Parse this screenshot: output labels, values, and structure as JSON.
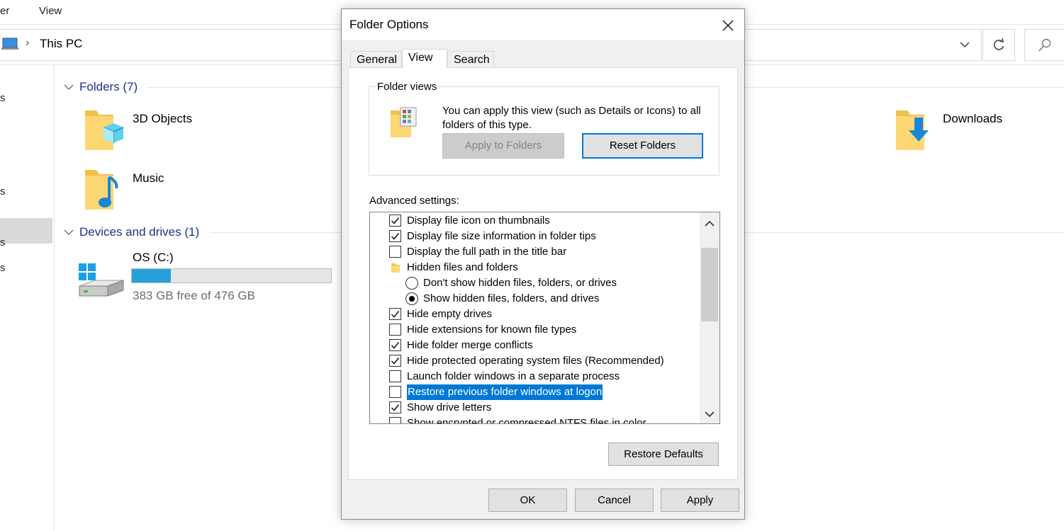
{
  "explorer": {
    "ribbon_tabs": [
      "er",
      "View"
    ],
    "breadcrumb": "This PC",
    "nav_fragments": [
      "s",
      "s",
      "s",
      "s"
    ],
    "groups": [
      {
        "label": "Folders (7)"
      },
      {
        "label": "Devices and drives (1)"
      }
    ],
    "folders": [
      {
        "name": "3D Objects",
        "icon": "3d-objects-folder-icon"
      },
      {
        "name": "Music",
        "icon": "music-folder-icon"
      },
      {
        "name": "Downloads",
        "icon": "downloads-folder-icon"
      }
    ],
    "drive": {
      "name": "OS (C:)",
      "free_text": "383 GB free of 476 GB",
      "used_fraction": 0.195,
      "bar_color": "#26a0da"
    }
  },
  "dialog": {
    "title": "Folder Options",
    "tabs": [
      "General",
      "View",
      "Search"
    ],
    "active_tab": "View",
    "folder_views": {
      "legend": "Folder views",
      "description": "You can apply this view (such as Details or Icons) to all folders of this type.",
      "apply_label": "Apply to Folders",
      "reset_label": "Reset Folders"
    },
    "advanced_label": "Advanced settings:",
    "settings": [
      {
        "kind": "checkbox",
        "checked": true,
        "label": "Display file icon on thumbnails"
      },
      {
        "kind": "checkbox",
        "checked": true,
        "label": "Display file size information in folder tips"
      },
      {
        "kind": "checkbox",
        "checked": false,
        "label": "Display the full path in the title bar"
      },
      {
        "kind": "folder",
        "label": "Hidden files and folders"
      },
      {
        "kind": "radio",
        "checked": false,
        "label": "Don't show hidden files, folders, or drives"
      },
      {
        "kind": "radio",
        "checked": true,
        "label": "Show hidden files, folders, and drives"
      },
      {
        "kind": "checkbox",
        "checked": true,
        "label": "Hide empty drives"
      },
      {
        "kind": "checkbox",
        "checked": false,
        "label": "Hide extensions for known file types"
      },
      {
        "kind": "checkbox",
        "checked": true,
        "label": "Hide folder merge conflicts"
      },
      {
        "kind": "checkbox",
        "checked": true,
        "label": "Hide protected operating system files (Recommended)"
      },
      {
        "kind": "checkbox",
        "checked": false,
        "label": "Launch folder windows in a separate process"
      },
      {
        "kind": "checkbox",
        "checked": false,
        "label": "Restore previous folder windows at logon",
        "selected": true
      },
      {
        "kind": "checkbox",
        "checked": true,
        "label": "Show drive letters"
      },
      {
        "kind": "checkbox",
        "checked": false,
        "label": "Show encrypted or compressed NTFS files in color"
      }
    ],
    "restore_defaults_label": "Restore Defaults",
    "ok_label": "OK",
    "cancel_label": "Cancel",
    "apply_label": "Apply",
    "accent_color": "#0078d7"
  }
}
